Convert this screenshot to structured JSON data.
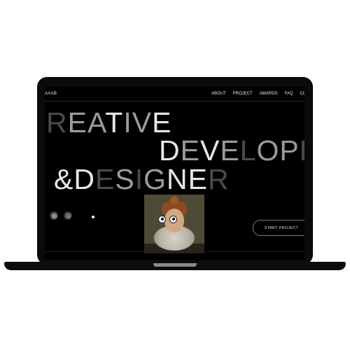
{
  "site": {
    "logo": "AAAB",
    "nav": [
      "ABOUT",
      "PROJECT",
      "AWARDS",
      "FAQ",
      "CO"
    ]
  },
  "hero": {
    "line1": [
      "R",
      "E",
      "A",
      "T",
      "I",
      "V",
      "E"
    ],
    "line2": [
      "D",
      "E",
      "V",
      "E",
      "L",
      "O",
      "P",
      "E"
    ],
    "line3": [
      "&",
      "D",
      "E",
      "S",
      "I",
      "G",
      "N",
      "E",
      "R"
    ],
    "cta": "START PROJECT"
  },
  "social": {
    "icons": [
      "instagram-icon",
      "info-icon"
    ]
  },
  "colors": {
    "bright": "#e6e6e6",
    "mid": "#9a9a9a",
    "dark": "#4a4a4a",
    "screen": "#000000"
  }
}
